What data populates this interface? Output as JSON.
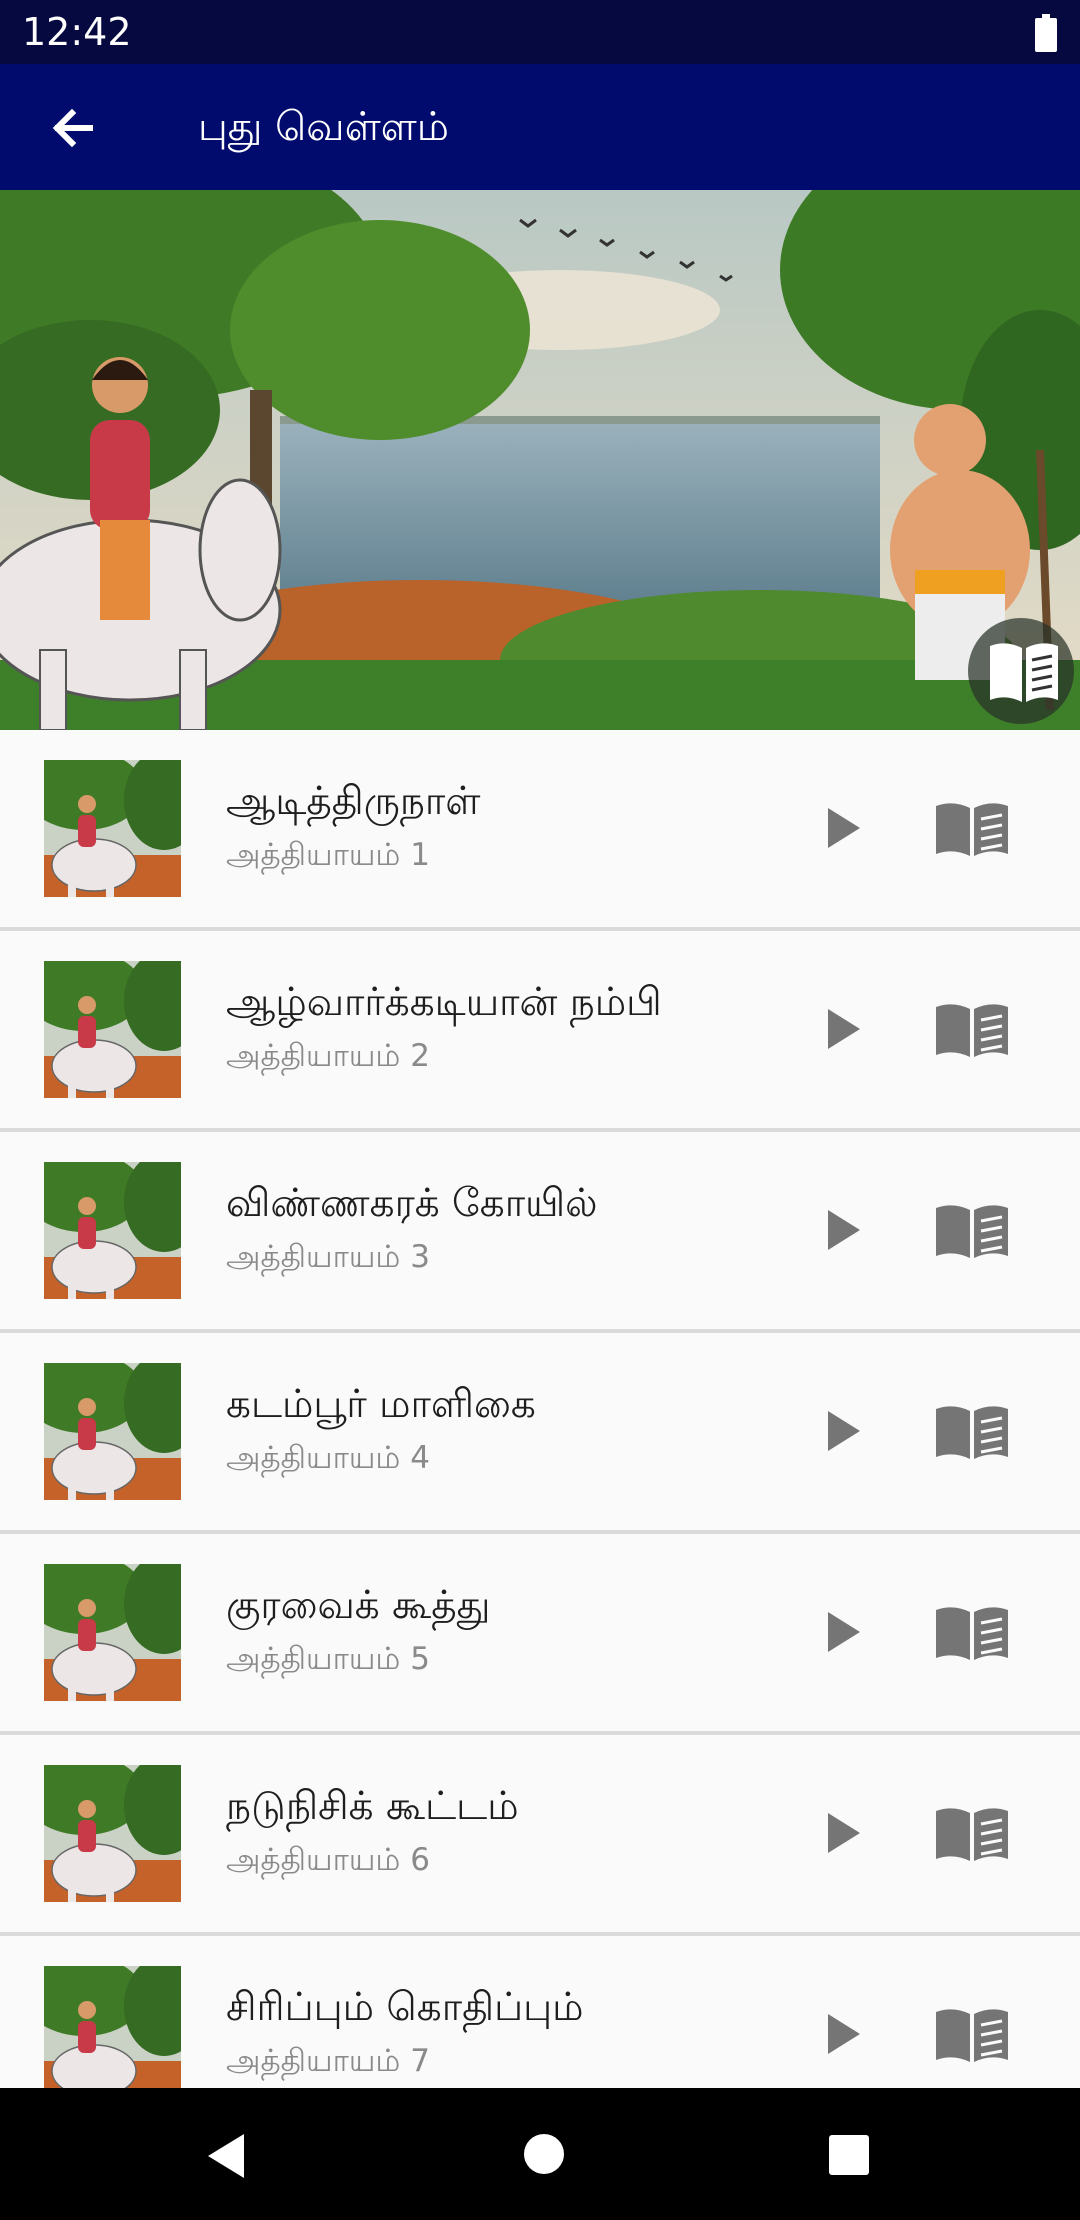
{
  "status_bar": {
    "time": "12:42",
    "battery_icon": "battery-icon"
  },
  "app_bar": {
    "title": "புது வெள்ளம்",
    "back_icon": "arrow-back-icon"
  },
  "hero": {
    "image": "story-illustration-rider-and-man-by-river",
    "read_icon": "book-open-icon"
  },
  "chapters": [
    {
      "title": "ஆடித்திருநாள்",
      "subtitle": "அத்தியாயம் 1"
    },
    {
      "title": "ஆழ்வார்க்கடியான் நம்பி",
      "subtitle": "அத்தியாயம் 2"
    },
    {
      "title": "விண்ணகரக் கோயில்",
      "subtitle": "அத்தியாயம் 3"
    },
    {
      "title": "கடம்பூர் மாளிகை",
      "subtitle": "அத்தியாயம் 4"
    },
    {
      "title": "குரவைக் கூத்து",
      "subtitle": "அத்தியாயம் 5"
    },
    {
      "title": "நடுநிசிக் கூட்டம்",
      "subtitle": "அத்தியாயம் 6"
    },
    {
      "title": "சிரிப்பும் கொதிப்பும்",
      "subtitle": "அத்தியாயம் 7"
    }
  ],
  "row_icons": {
    "play": "play-icon",
    "read": "book-open-icon"
  },
  "nav_bar": {
    "back": "nav-back-icon",
    "home": "nav-home-icon",
    "recents": "nav-recents-icon"
  },
  "colors": {
    "status_bar": "#05093f",
    "app_bar": "#010b6d",
    "icon_gray": "#757575",
    "divider": "#dadada"
  }
}
